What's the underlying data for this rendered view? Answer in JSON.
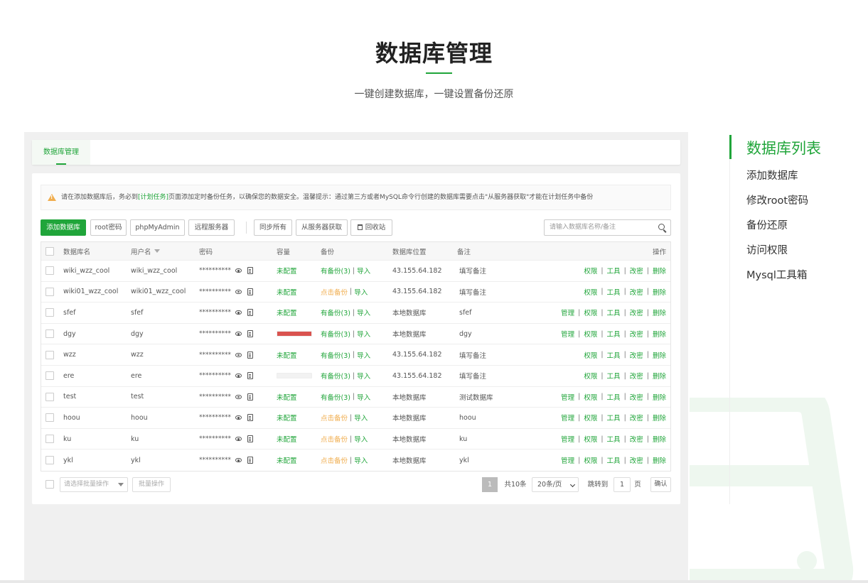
{
  "hero": {
    "title": "数据库管理",
    "subtitle": "一键创建数据库，一键设置备份还原"
  },
  "panel": {
    "tab_label": "数据库管理",
    "alert": {
      "prefix": "请在添加数据库后，务必到",
      "link": "[计划任务]",
      "suffix": "页面添加定时备份任务，以确保您的数据安全。温馨提示：通过第三方或者MySQL命令行创建的数据库需要点击\"从服务器获取\"才能在计划任务中备份"
    },
    "toolbar": {
      "add_db": "添加数据库",
      "root_pwd": "root密码",
      "phpmyadmin": "phpMyAdmin",
      "remote_server": "远程服务器",
      "sync_all": "同步所有",
      "get_from_server": "从服务器获取",
      "recycle_bin": "回收站",
      "search_placeholder": "请输入数据库名称/备注"
    },
    "table": {
      "headers": {
        "name": "数据库名",
        "user": "用户名",
        "password": "密码",
        "capacity": "容量",
        "backup": "备份",
        "location": "数据库位置",
        "note": "备注",
        "ops": "操作"
      },
      "rows": [
        {
          "name": "wiki_wzz_cool",
          "user": "wiki_wzz_cool",
          "password": "**********",
          "capacity": "未配置",
          "capacity_type": "text",
          "backup": "有备份(3)",
          "backup_type": "has",
          "import": "导入",
          "location": "43.155.64.182",
          "note": "填写备注",
          "manage": false
        },
        {
          "name": "wiki01_wzz_cool",
          "user": "wiki01_wzz_cool",
          "password": "**********",
          "capacity": "未配置",
          "capacity_type": "text",
          "backup": "点击备份",
          "backup_type": "none",
          "import": "导入",
          "location": "43.155.64.182",
          "note": "填写备注",
          "manage": false
        },
        {
          "name": "sfef",
          "user": "sfef",
          "password": "**********",
          "capacity": "未配置",
          "capacity_type": "text",
          "backup": "有备份(3)",
          "backup_type": "has",
          "import": "导入",
          "location": "本地数据库",
          "note": "sfef",
          "manage": true
        },
        {
          "name": "dgy",
          "user": "dgy",
          "password": "**********",
          "capacity": "",
          "capacity_type": "bar",
          "capacity_fill": 1.0,
          "backup": "有备份(3)",
          "backup_type": "has",
          "import": "导入",
          "location": "本地数据库",
          "note": "dgy",
          "manage": true
        },
        {
          "name": "wzz",
          "user": "wzz",
          "password": "**********",
          "capacity": "未配置",
          "capacity_type": "text",
          "backup": "有备份(3)",
          "backup_type": "has",
          "import": "导入",
          "location": "43.155.64.182",
          "note": "填写备注",
          "manage": false
        },
        {
          "name": "ere",
          "user": "ere",
          "password": "**********",
          "capacity": "",
          "capacity_type": "bar",
          "capacity_fill": 0.0,
          "backup": "有备份(3)",
          "backup_type": "has",
          "import": "导入",
          "location": "43.155.64.182",
          "note": "填写备注",
          "manage": false
        },
        {
          "name": "test",
          "user": "test",
          "password": "**********",
          "capacity": "未配置",
          "capacity_type": "text",
          "backup": "有备份(3)",
          "backup_type": "has",
          "import": "导入",
          "location": "本地数据库",
          "note": "测试数据库",
          "manage": true
        },
        {
          "name": "hoou",
          "user": "hoou",
          "password": "**********",
          "capacity": "未配置",
          "capacity_type": "text",
          "backup": "点击备份",
          "backup_type": "none",
          "import": "导入",
          "location": "本地数据库",
          "note": "hoou",
          "manage": true
        },
        {
          "name": "ku",
          "user": "ku",
          "password": "**********",
          "capacity": "未配置",
          "capacity_type": "text",
          "backup": "点击备份",
          "backup_type": "none",
          "import": "导入",
          "location": "本地数据库",
          "note": "ku",
          "manage": true
        },
        {
          "name": "ykl",
          "user": "ykl",
          "password": "**********",
          "capacity": "未配置",
          "capacity_type": "text",
          "backup": "点击备份",
          "backup_type": "none",
          "import": "导入",
          "location": "本地数据库",
          "note": "ykl",
          "manage": true
        }
      ],
      "op_labels": {
        "manage": "管理",
        "perm": "权限",
        "tools": "工具",
        "change_pwd": "改密",
        "delete": "删除"
      }
    },
    "footer": {
      "batch_select_placeholder": "请选择批量操作",
      "batch_button": "批量操作",
      "current_page": "1",
      "total": "共10条",
      "page_size": "20条/页",
      "jump_to": "跳转到",
      "jump_value": "1",
      "page_unit": "页",
      "confirm": "确认"
    }
  },
  "side_nav": {
    "items": [
      {
        "label": "数据库列表",
        "active": true
      },
      {
        "label": "添加数据库",
        "active": false
      },
      {
        "label": "修改root密码",
        "active": false
      },
      {
        "label": "备份还原",
        "active": false
      },
      {
        "label": "访问权限",
        "active": false
      },
      {
        "label": "Mysql工具箱",
        "active": false
      }
    ]
  },
  "colors": {
    "accent": "#20a53a",
    "warning": "#f0ad4e",
    "danger": "#d9534f"
  }
}
